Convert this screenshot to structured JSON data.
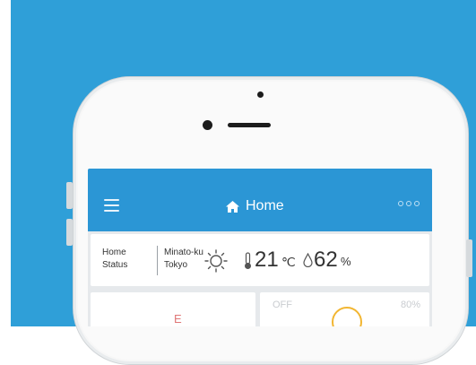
{
  "header": {
    "title": "Home",
    "home_icon": "home-icon",
    "menu_icon": "hamburger-menu-icon",
    "more_icon": "more-dots-icon",
    "color": "#2b96d5"
  },
  "status": {
    "label_line1": "Home",
    "label_line2": "Status",
    "location_line1": "Minato-ku",
    "location_line2": "Tokyo",
    "weather_icon": "sun-icon",
    "temperature": "21",
    "temperature_unit": "℃",
    "humidity": "62",
    "humidity_unit": "%"
  },
  "cards": {
    "left_partial_text": "E",
    "right_state": "OFF",
    "right_level": "80%"
  },
  "colors": {
    "background": "#2f9fd8",
    "accent_ring": "#f2b632"
  }
}
